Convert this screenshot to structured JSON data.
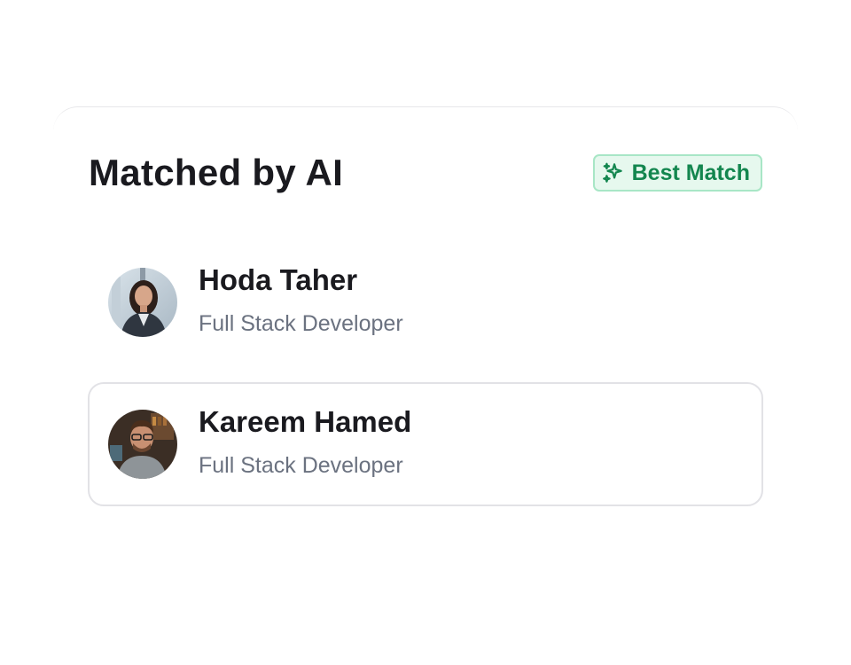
{
  "header": {
    "title": "Matched by AI",
    "badge_label": "Best Match",
    "badge_icon": "sparkles-icon"
  },
  "candidates": [
    {
      "name": "Hoda Taher",
      "role": "Full Stack Developer",
      "avatar": "avatar-photo",
      "selected": false
    },
    {
      "name": "Kareem Hamed",
      "role": "Full Stack Developer",
      "avatar": "avatar-photo",
      "selected": true
    }
  ],
  "colors": {
    "badge_text": "#13864f",
    "badge_background": "#e6f8ee",
    "badge_border": "#a8e6c6",
    "title_text": "#1a1a1f",
    "role_text": "#6b7280",
    "selected_border": "#e2e2e6"
  }
}
